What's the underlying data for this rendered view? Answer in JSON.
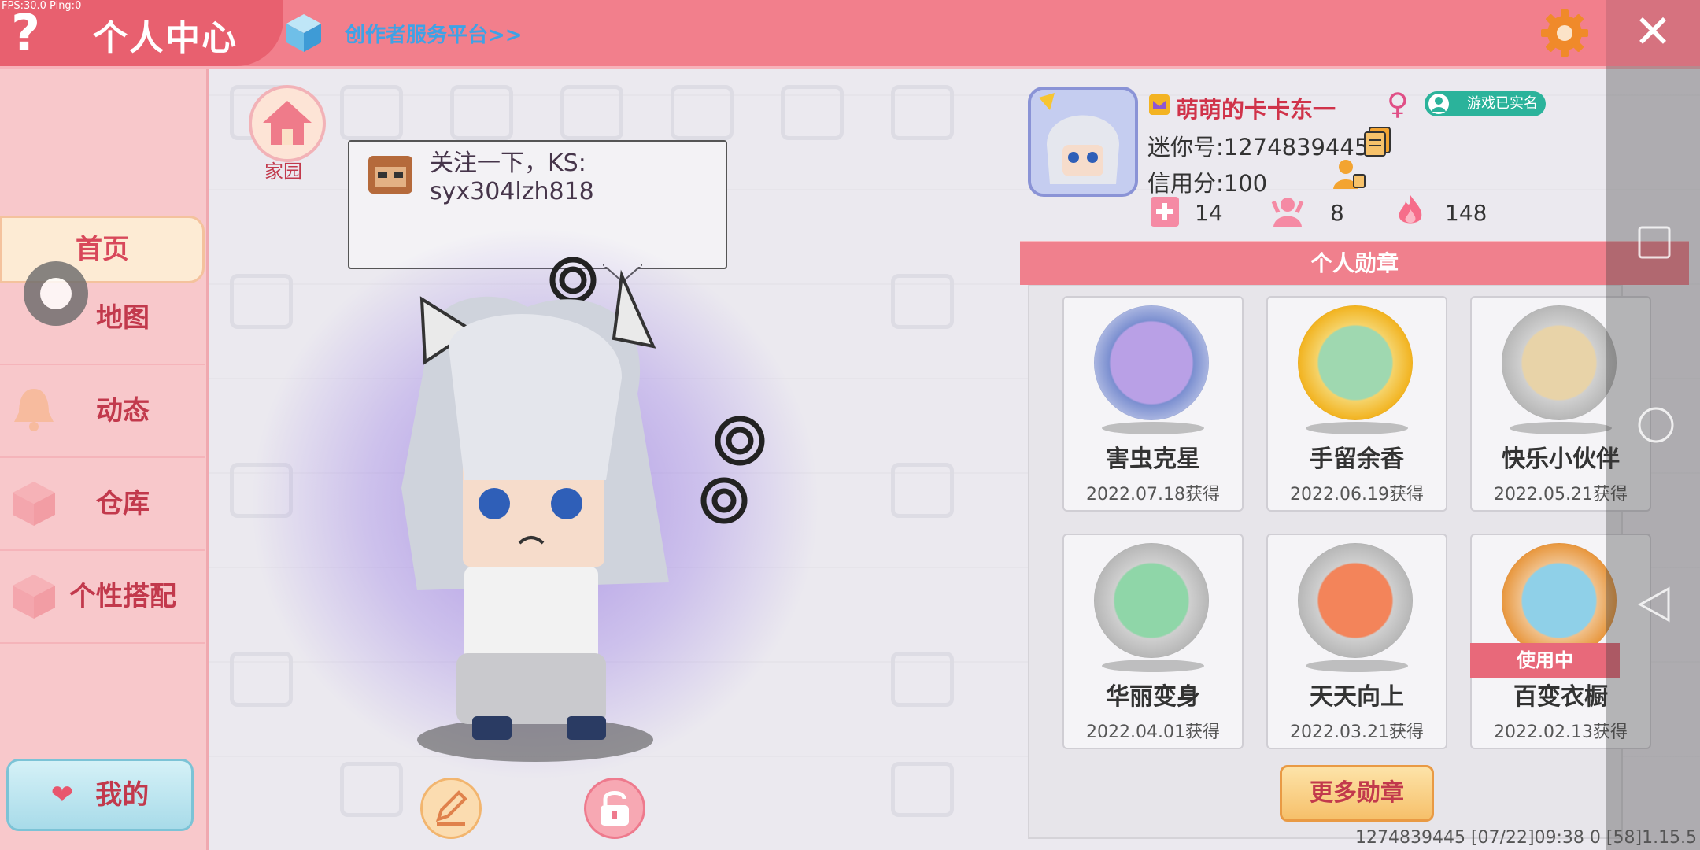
{
  "fps_text": "FPS:30.0  Ping:0",
  "header": {
    "title": "个人中心",
    "creator_link": "创作者服务平台>>",
    "help_glyph": "?",
    "close_glyph": "✕"
  },
  "sidebar": {
    "items": [
      {
        "label": "首页",
        "icon": "home"
      },
      {
        "label": "地图",
        "icon": "map-icon"
      },
      {
        "label": "动态",
        "icon": "bell-icon"
      },
      {
        "label": "仓库",
        "icon": "box-icon"
      },
      {
        "label": "个性搭配",
        "icon": "outfit-icon"
      }
    ],
    "mine_label": "我的"
  },
  "home_button_label": "家园",
  "bubble": {
    "line1": "关注一下，KS:",
    "line2": "syx304lzh818"
  },
  "profile": {
    "username": "萌萌的卡卡东一",
    "gender_glyph": "♀",
    "realname_badge": "游戏已实名",
    "mini_id": "迷你号:1274839445",
    "credit": "信用分:100",
    "stats": [
      "14",
      "8",
      "148"
    ]
  },
  "badges": {
    "header": "个人勋章",
    "items": [
      {
        "name": "害虫克星",
        "date": "2022.07.18获得"
      },
      {
        "name": "手留余香",
        "date": "2022.06.19获得"
      },
      {
        "name": "快乐小伙伴",
        "date": "2022.05.21获得"
      },
      {
        "name": "华丽变身",
        "date": "2022.04.01获得"
      },
      {
        "name": "天天向上",
        "date": "2022.03.21获得"
      },
      {
        "name": "百变衣橱",
        "date": "2022.02.13获得"
      }
    ],
    "in_use_label": "使用中",
    "more_label": "更多勋章"
  },
  "footer_info": "1274839445  [07/22]09:38 0  [58]1.15.5",
  "colors": {
    "accent": "#f27f8c",
    "brand_red": "#c2394c",
    "panel": "#e7e5ea"
  }
}
